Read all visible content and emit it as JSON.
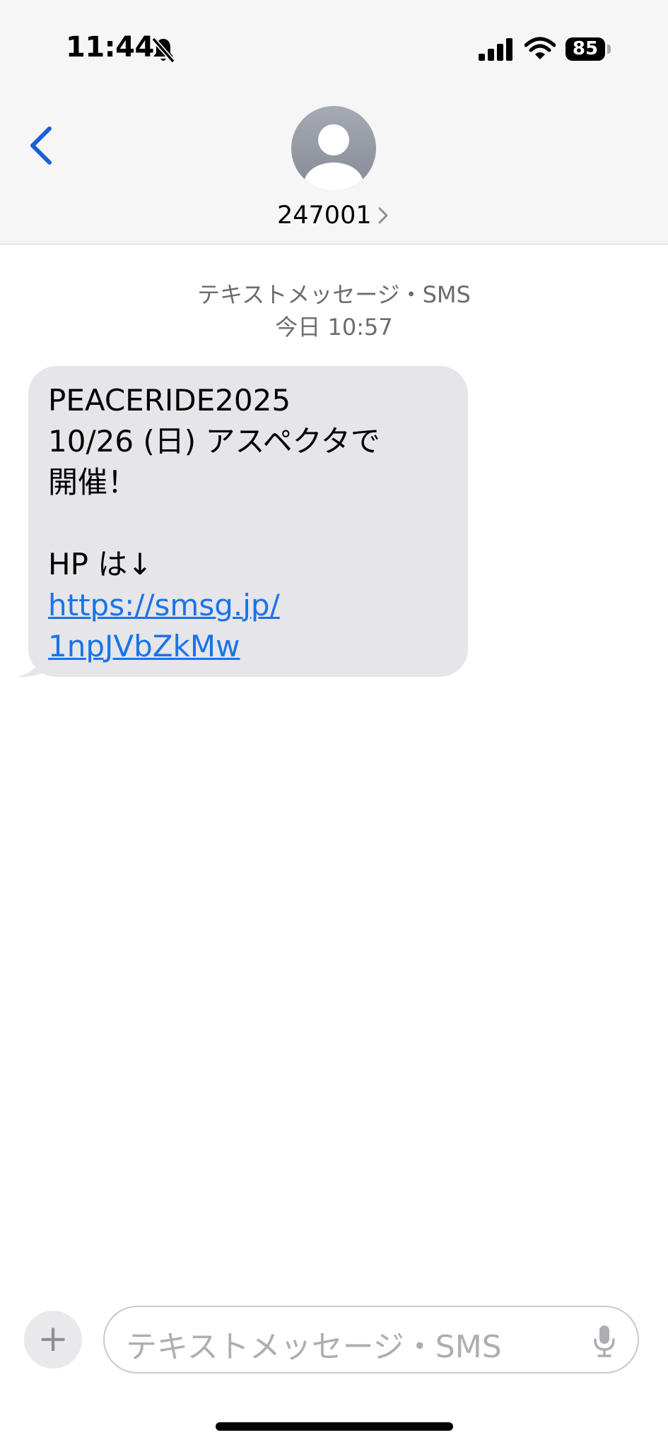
{
  "status_bar": {
    "time": "11:44",
    "battery": "85"
  },
  "header": {
    "contact_name": "247001"
  },
  "conversation": {
    "service_label": "テキストメッセージ・SMS",
    "timestamp": "今日 10:57",
    "message": {
      "lines": [
        "PEACERIDE2025",
        "10/26 (日) アスペクタで",
        "開催！",
        "",
        "HP は↓"
      ],
      "link_lines": [
        "https://smsg.jp/",
        "1npJVbZkMw"
      ]
    }
  },
  "composer": {
    "add_label": "+",
    "placeholder": "テキストメッセージ・SMS"
  },
  "colors": {
    "accent": "#1a73e8",
    "bubble": "#e5e5ea",
    "header_bg": "#f6f6f6"
  },
  "icons": {
    "back": "chevron-left-icon",
    "avatar": "person-icon",
    "bell": "bell-slash-icon",
    "mic": "microphone-icon"
  }
}
